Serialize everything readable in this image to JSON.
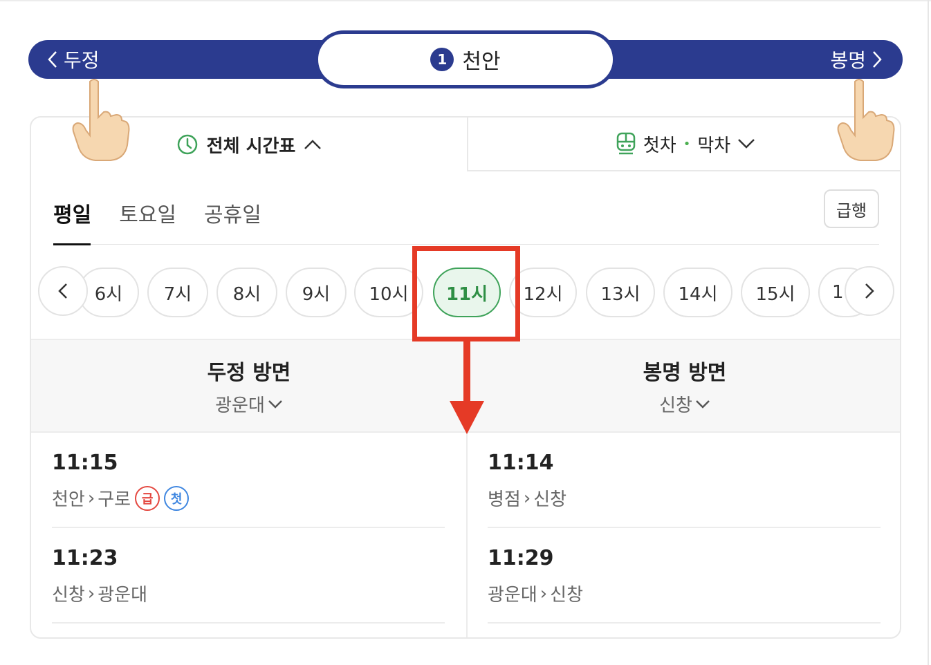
{
  "station_nav": {
    "prev_label": "두정",
    "current_line_number": "1",
    "current_station": "천안",
    "next_label": "봉명",
    "line_color": "#2b3b8f"
  },
  "view_tabs": {
    "timetable_label": "전체 시간표",
    "first_last_first": "첫차",
    "first_last_sep": "•",
    "first_last_last": "막차"
  },
  "day_tabs": [
    {
      "label": "평일",
      "active": true
    },
    {
      "label": "토요일",
      "active": false
    },
    {
      "label": "공휴일",
      "active": false
    }
  ],
  "express_button": "급행",
  "hours": [
    {
      "label": "6시"
    },
    {
      "label": "7시"
    },
    {
      "label": "8시"
    },
    {
      "label": "9시"
    },
    {
      "label": "10시"
    },
    {
      "label": "11시"
    },
    {
      "label": "12시"
    },
    {
      "label": "13시"
    },
    {
      "label": "14시"
    },
    {
      "label": "15시"
    },
    {
      "label": "1"
    }
  ],
  "selected_hour": "11시",
  "directions": {
    "left": {
      "title": "두정 방면",
      "via": "광운대"
    },
    "right": {
      "title": "봉명 방면",
      "via": "신창"
    }
  },
  "departures": {
    "left": [
      {
        "time": "11:15",
        "from": "천안",
        "to": "구로",
        "badges": [
          "급",
          "첫"
        ]
      },
      {
        "time": "11:23",
        "from": "신창",
        "to": "광운대",
        "badges": []
      }
    ],
    "right": [
      {
        "time": "11:14",
        "from": "병점",
        "to": "신창",
        "badges": []
      },
      {
        "time": "11:29",
        "from": "광운대",
        "to": "신창",
        "badges": []
      }
    ]
  },
  "colors": {
    "accent_green": "#3fa35a",
    "highlight_red": "#e53a26",
    "express_badge": "#e4473f",
    "first_badge": "#3e86e0"
  }
}
